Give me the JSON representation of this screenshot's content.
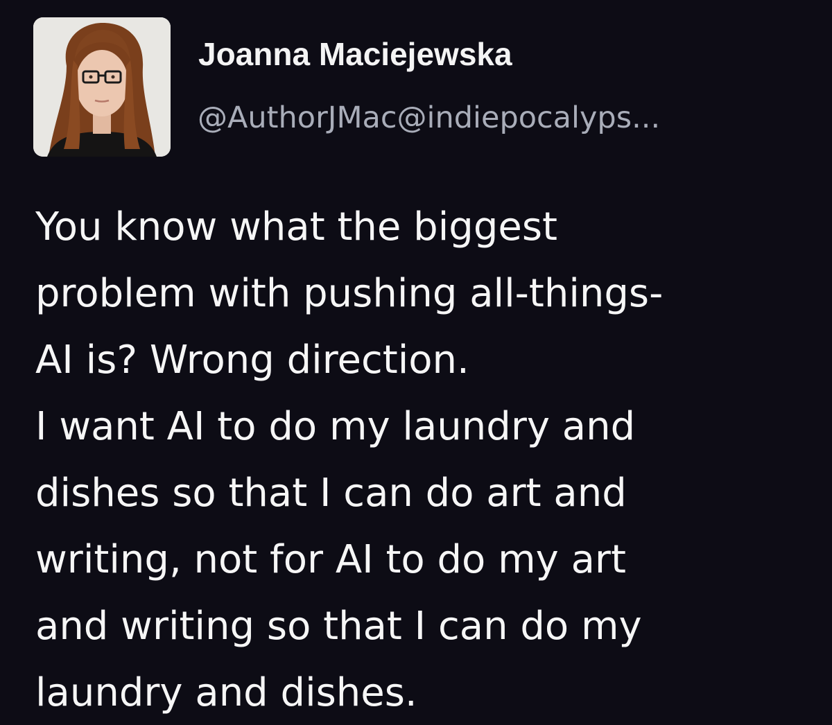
{
  "post": {
    "author": {
      "display_name": "Joanna Maciejewska",
      "handle": "@AuthorJMac@indiepocalyps..."
    },
    "text_lines": [
      "You know what the biggest",
      "problem with pushing all-things-",
      "AI is? Wrong direction.",
      "I want AI to do my laundry and",
      "dishes so that I can do art and",
      "writing, not for AI to do my art",
      "and writing so that I can do my",
      "laundry and dishes."
    ]
  },
  "colors": {
    "background": "#0d0c15",
    "text": "#f6f6f6",
    "handle": "#a9adb9"
  }
}
